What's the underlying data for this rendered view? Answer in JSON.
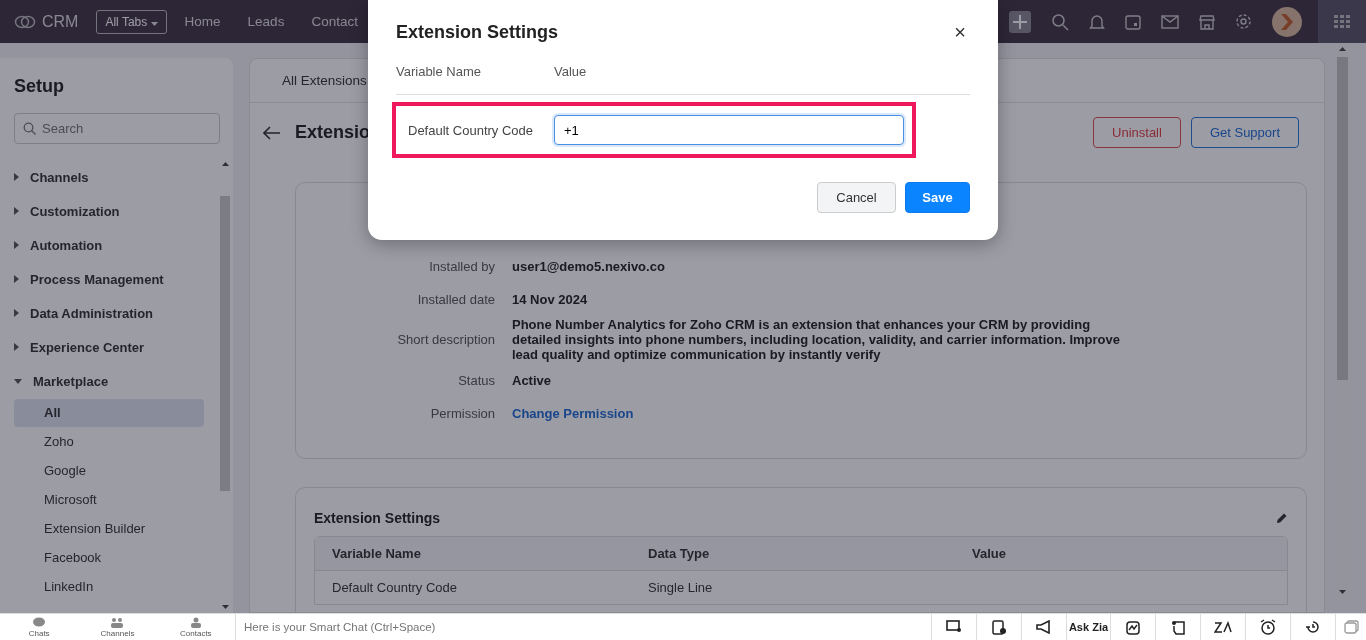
{
  "topbar": {
    "logo": "CRM",
    "all_tabs": "All Tabs",
    "nav": [
      "Home",
      "Leads",
      "Contact"
    ]
  },
  "sidebar": {
    "title": "Setup",
    "search": {
      "placeholder": "Search"
    },
    "groups": [
      {
        "label": "Channels",
        "expanded": false
      },
      {
        "label": "Customization",
        "expanded": false
      },
      {
        "label": "Automation",
        "expanded": false
      },
      {
        "label": "Process Management",
        "expanded": false
      },
      {
        "label": "Data Administration",
        "expanded": false
      },
      {
        "label": "Experience Center",
        "expanded": false
      },
      {
        "label": "Marketplace",
        "expanded": true,
        "children": [
          {
            "label": "All",
            "selected": true
          },
          {
            "label": "Zoho",
            "selected": false
          },
          {
            "label": "Google",
            "selected": false
          },
          {
            "label": "Microsoft",
            "selected": false
          },
          {
            "label": "Extension Builder",
            "selected": false
          },
          {
            "label": "Facebook",
            "selected": false
          },
          {
            "label": "LinkedIn",
            "selected": false
          }
        ]
      }
    ]
  },
  "main": {
    "tab": "All Extensions",
    "title": "Extensio",
    "buttons": [
      {
        "label": "Uninstall",
        "kind": "danger"
      },
      {
        "label": "Get Support",
        "kind": "primary"
      }
    ],
    "details": [
      {
        "label": "Installed by",
        "value": "user1@demo5.nexivo.co",
        "kind": "text"
      },
      {
        "label": "Installed date",
        "value": "14 Nov 2024",
        "kind": "text"
      },
      {
        "label": "Short description",
        "value": "Phone Number Analytics for Zoho CRM is an extension that enhances your CRM by providing detailed insights into phone numbers, including location, validity, and carrier information. Improve lead quality and optimize communication by instantly verify",
        "kind": "text"
      },
      {
        "label": "Status",
        "value": "Active",
        "kind": "text"
      },
      {
        "label": "Permission",
        "value": "Change Permission",
        "kind": "link"
      }
    ],
    "settings": {
      "title": "Extension Settings",
      "columns": [
        "Variable Name",
        "Data Type",
        "Value"
      ],
      "rows": [
        [
          "Default Country Code",
          "Single Line",
          ""
        ]
      ]
    }
  },
  "modal": {
    "title": "Extension Settings",
    "close": "×",
    "columns": [
      "Variable Name",
      "Value"
    ],
    "row": {
      "label": "Default Country Code",
      "value": "+1",
      "highlighted": true
    },
    "buttons": [
      {
        "label": "Cancel",
        "kind": "secondary"
      },
      {
        "label": "Save",
        "kind": "primary"
      }
    ]
  },
  "bottombar": {
    "tabs": [
      "Chats",
      "Channels",
      "Contacts"
    ],
    "chat_placeholder": "Here is your Smart Chat (Ctrl+Space)",
    "ask_zia": "Ask Zia"
  }
}
